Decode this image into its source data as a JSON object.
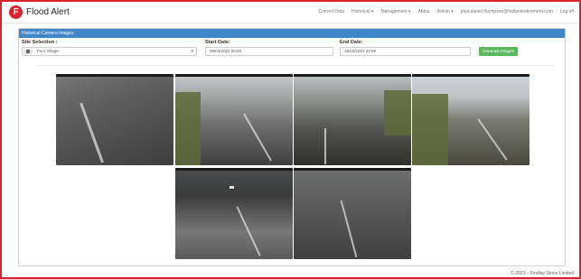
{
  "app": {
    "title": "Flood Alert",
    "logo_letter": "F"
  },
  "nav": {
    "links": [
      "Current Data",
      "Historical ▾",
      "Management ▾",
      "About",
      "Admin ▾",
      "paul.daniel.thompson@hollandretirement.com",
      "Log off"
    ]
  },
  "panel": {
    "title": "Historical Camera Images"
  },
  "filters": {
    "site_label": "Site Selection :",
    "site_value": "Four Village",
    "start_label": "Start Date:",
    "start_value": "09/03/2023 00:00",
    "end_label": "End Date:",
    "end_value": "15/03/2023 23:59",
    "button_label": "Generate Images"
  },
  "footer": {
    "text": "© 2023 – Findlay Stone Limited"
  },
  "icons": {
    "logo": "flood-alert-logo",
    "site": "camera-icon",
    "caret": "chevron-down-icon"
  },
  "colors": {
    "accent": "#d9232d",
    "panel_header": "#3f87c9",
    "button": "#5cb85c"
  }
}
